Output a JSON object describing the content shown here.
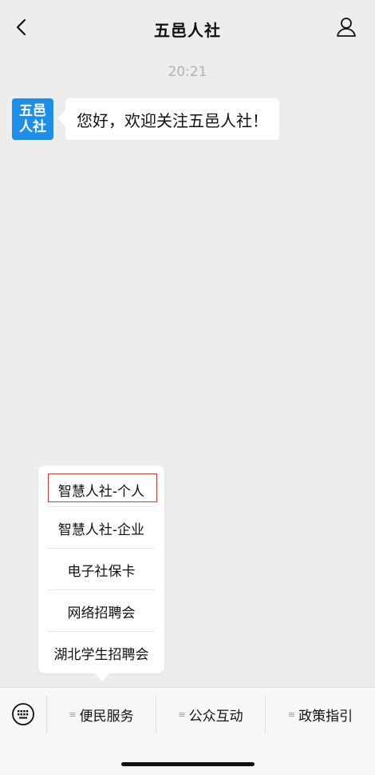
{
  "header": {
    "title": "五邑人社",
    "back_icon": "chevron-left-icon",
    "profile_icon": "person-icon"
  },
  "chat": {
    "timestamp": "20:21",
    "message": {
      "avatar_line1": "五邑",
      "avatar_line2": "人社",
      "avatar_color": "#1f8ee6",
      "text": "您好，欢迎关注五邑人社！"
    }
  },
  "popup_menu": {
    "items": [
      "智慧人社-个人",
      "智慧人社-企业",
      "电子社保卡",
      "网络招聘会",
      "湖北学生招聘会"
    ],
    "highlight_color": "#e0352b"
  },
  "bottom_bar": {
    "keyboard_icon": "keyboard-icon",
    "tabs": [
      {
        "mark": "≡",
        "label": "便民服务"
      },
      {
        "mark": "≡",
        "label": "公众互动"
      },
      {
        "mark": "≡",
        "label": "政策指引"
      }
    ]
  }
}
